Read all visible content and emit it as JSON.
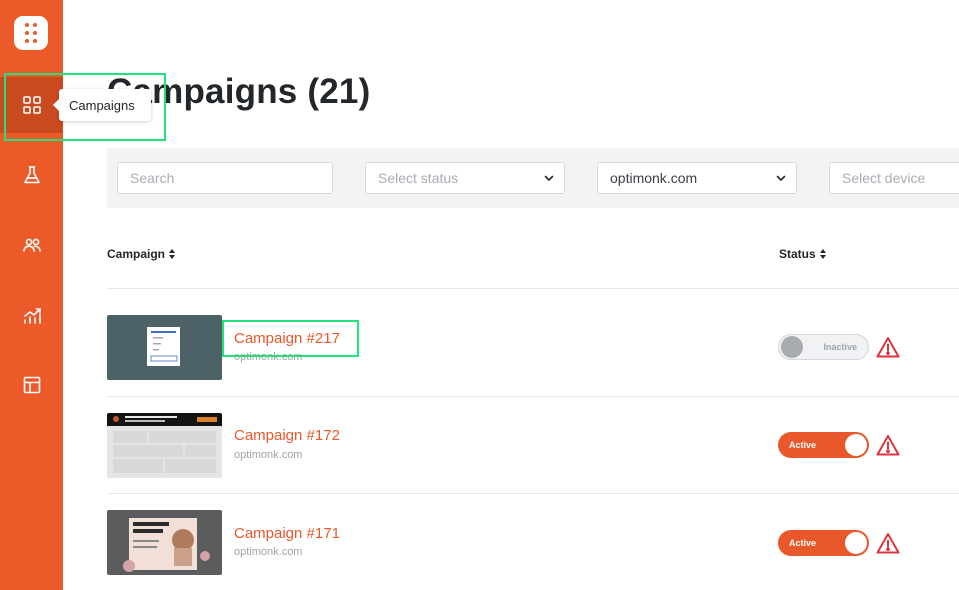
{
  "sidebar": {
    "items": [
      {
        "id": "campaigns",
        "icon": "grid-icon",
        "active": true
      },
      {
        "id": "experiments",
        "icon": "flask-icon",
        "active": false
      },
      {
        "id": "subscribers",
        "icon": "users-icon",
        "active": false
      },
      {
        "id": "analytics",
        "icon": "chart-icon",
        "active": false
      },
      {
        "id": "templates",
        "icon": "layout-icon",
        "active": false
      }
    ],
    "tooltip": "Campaigns"
  },
  "page": {
    "title": "Campaigns (21)"
  },
  "filters": {
    "search_placeholder": "Search",
    "status_placeholder": "Select status",
    "domain_value": "optimonk.com",
    "device_placeholder": "Select device"
  },
  "table": {
    "headers": {
      "campaign": "Campaign",
      "status": "Status"
    },
    "rows": [
      {
        "name": "Campaign #217",
        "domain": "optimonk.com",
        "status": "Inactive",
        "active": false
      },
      {
        "name": "Campaign #172",
        "domain": "optimonk.com",
        "status": "Active",
        "active": true
      },
      {
        "name": "Campaign #171",
        "domain": "optimonk.com",
        "status": "Active",
        "active": true
      }
    ]
  },
  "colors": {
    "brand": "#ed5a29",
    "highlight": "#22e07a",
    "warning": "#d9363e"
  }
}
